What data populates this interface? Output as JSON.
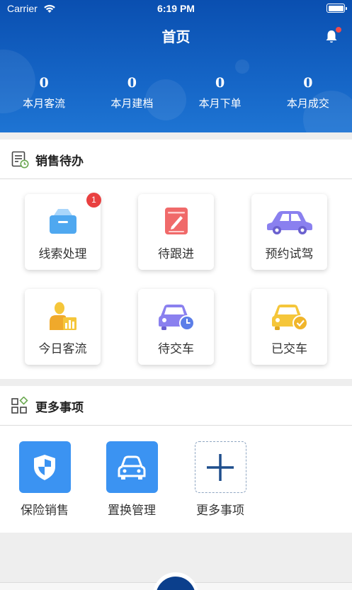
{
  "status_bar": {
    "carrier": "Carrier",
    "time": "6:19 PM"
  },
  "header": {
    "title": "首页"
  },
  "stats": [
    {
      "value": "0",
      "label": "本月客流"
    },
    {
      "value": "0",
      "label": "本月建档"
    },
    {
      "value": "0",
      "label": "本月下单"
    },
    {
      "value": "0",
      "label": "本月成交"
    }
  ],
  "sales_todo": {
    "title": "销售待办",
    "items": [
      {
        "label": "线索处理",
        "icon": "inbox-icon",
        "badge": "1"
      },
      {
        "label": "待跟进",
        "icon": "notebook-icon"
      },
      {
        "label": "预约试驾",
        "icon": "car-side-icon"
      },
      {
        "label": "今日客流",
        "icon": "person-chart-icon"
      },
      {
        "label": "待交车",
        "icon": "car-clock-icon"
      },
      {
        "label": "已交车",
        "icon": "car-check-icon"
      }
    ]
  },
  "more": {
    "title": "更多事项",
    "items": [
      {
        "label": "保险销售",
        "icon": "shield-icon"
      },
      {
        "label": "置换管理",
        "icon": "car-front-icon"
      },
      {
        "label": "更多事项",
        "icon": "plus-icon"
      }
    ]
  },
  "colors": {
    "header_gradient_top": "#0a4fb0",
    "header_gradient_bottom": "#1e74d3",
    "accent_blue": "#3b93f2",
    "badge_red": "#e94040"
  }
}
